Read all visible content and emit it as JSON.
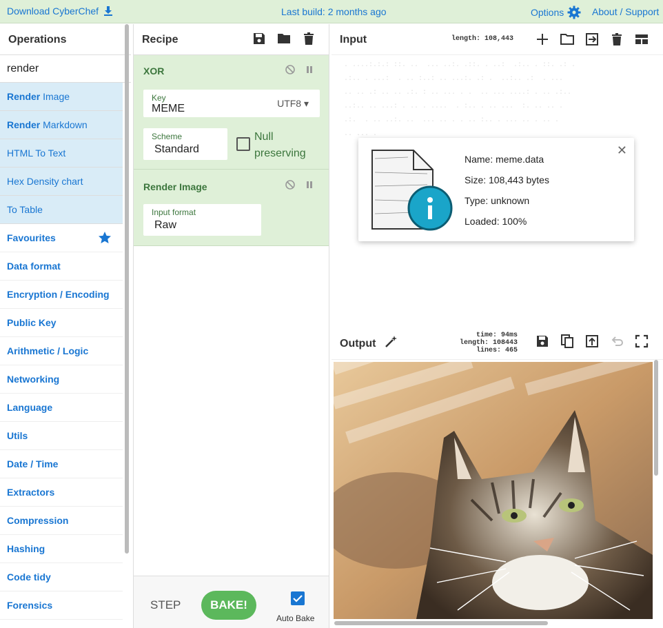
{
  "banner": {
    "download": "Download CyberChef",
    "last_build": "Last build: 2 months ago",
    "options": "Options",
    "about": "About / Support"
  },
  "operations": {
    "title": "Operations",
    "search_value": "render",
    "results": [
      {
        "bold": "Render",
        "rest": " Image"
      },
      {
        "bold": "Render",
        "rest": " Markdown"
      },
      {
        "bold": "",
        "rest": "HTML To Text"
      },
      {
        "bold": "",
        "rest": "Hex Density chart"
      },
      {
        "bold": "",
        "rest": "To Table"
      }
    ],
    "categories": [
      "Favourites",
      "Data format",
      "Encryption / Encoding",
      "Public Key",
      "Arithmetic / Logic",
      "Networking",
      "Language",
      "Utils",
      "Date / Time",
      "Extractors",
      "Compression",
      "Hashing",
      "Code tidy",
      "Forensics"
    ]
  },
  "recipe": {
    "title": "Recipe",
    "xor": {
      "title": "XOR",
      "key_label": "Key",
      "key_value": "MEME",
      "encoding": "UTF8",
      "scheme_label": "Scheme",
      "scheme_value": "Standard",
      "null_label_1": "Null",
      "null_label_2": "preserving"
    },
    "render_image": {
      "title": "Render Image",
      "format_label": "Input format",
      "format_value": "Raw"
    },
    "step": "STEP",
    "bake": "BAKE!",
    "auto_bake": "Auto Bake"
  },
  "input": {
    "title": "Input",
    "length": "length: 108,443",
    "file": {
      "name": "Name: meme.data",
      "size": "Size: 108,443 bytes",
      "type": "Type: unknown",
      "loaded": "Loaded: 100%"
    }
  },
  "output": {
    "title": "Output",
    "time": "time:   94ms",
    "length": "length: 108443",
    "lines": "lines:    465"
  },
  "colors": {
    "accent": "#1976d2",
    "green_bg": "#dff0d8",
    "green_text": "#3c763d",
    "bake": "#5cb85c"
  }
}
